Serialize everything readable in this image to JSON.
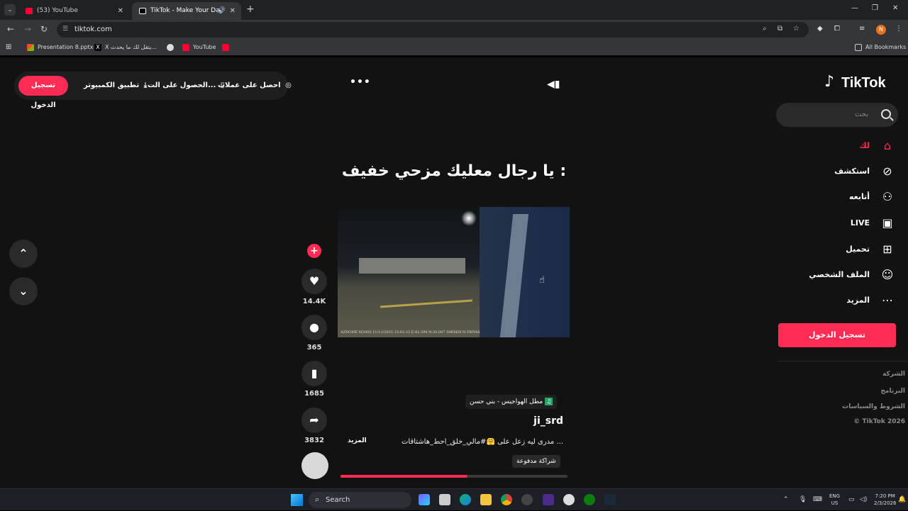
{
  "browser": {
    "tabs": [
      {
        "title": "(53) YouTube",
        "active": false
      },
      {
        "title": "TikTok - Make Your Day",
        "active": true
      }
    ],
    "url": "tiktok.com",
    "profile_initial": "N",
    "bookmarks": [
      {
        "label": "Presentation 8.pptx",
        "icon": "office-icon"
      },
      {
        "label": "X يتقل لك ما يحدث...",
        "icon": "x-icon"
      },
      {
        "label": "",
        "icon": "web-icon"
      },
      {
        "label": "YouTube",
        "icon": "youtube-icon"
      },
      {
        "label": "",
        "icon": "youtube-icon"
      }
    ],
    "all_bookmarks": "All Bookmarks"
  },
  "header": {
    "login_pill": "تسجيل الدخول",
    "desktop_app": "تطبيق الكمبيوتر",
    "get_app": "الحصول على الت...",
    "get_coins": "احصل على عملات",
    "logo_text": "TikTok"
  },
  "sidebar": {
    "search_placeholder": "بحث",
    "nav": [
      {
        "label": "لك",
        "icon": "home-icon",
        "active": true
      },
      {
        "label": "استكشف",
        "icon": "compass-icon",
        "active": false
      },
      {
        "label": "أتابعه",
        "icon": "following-icon",
        "active": false
      },
      {
        "label": "LIVE",
        "icon": "live-icon",
        "active": false
      },
      {
        "label": "تحميل",
        "icon": "upload-icon",
        "active": false
      },
      {
        "label": "الملف الشخصي",
        "icon": "profile-icon",
        "active": false
      },
      {
        "label": "المزيد",
        "icon": "more-icon",
        "active": false
      }
    ],
    "login_button": "تسجيل الدخول",
    "footer": [
      "الشركة",
      "البرنامج",
      "الشروط والسياسات",
      "© TikTok 2026"
    ]
  },
  "video": {
    "caption_overlay": "يا رجال معليك مزحي خفيف :",
    "camera_stamp": "AZDOME M300S 11/11/2025 15:02:23 E:42.590 N:20.007 59KM/H N:TRIYAS",
    "progress": 0.56,
    "likes": "14.4K",
    "comments": "365",
    "saves": "1685",
    "shares": "3832",
    "sound": "مطل الهواجيس - بني حسن",
    "username": "ji_srd",
    "description": "مدرى ليه زعل على 🤗#مالي_خلق_احط_هاشتاقات ...",
    "more_label": "المزيد",
    "paid_tag": "شراكة مدفوعة"
  },
  "taskbar": {
    "search_label": "Search",
    "lang_top": "ENG",
    "lang_bottom": "US",
    "time": "7:20 PM",
    "date": "2/3/2026"
  }
}
